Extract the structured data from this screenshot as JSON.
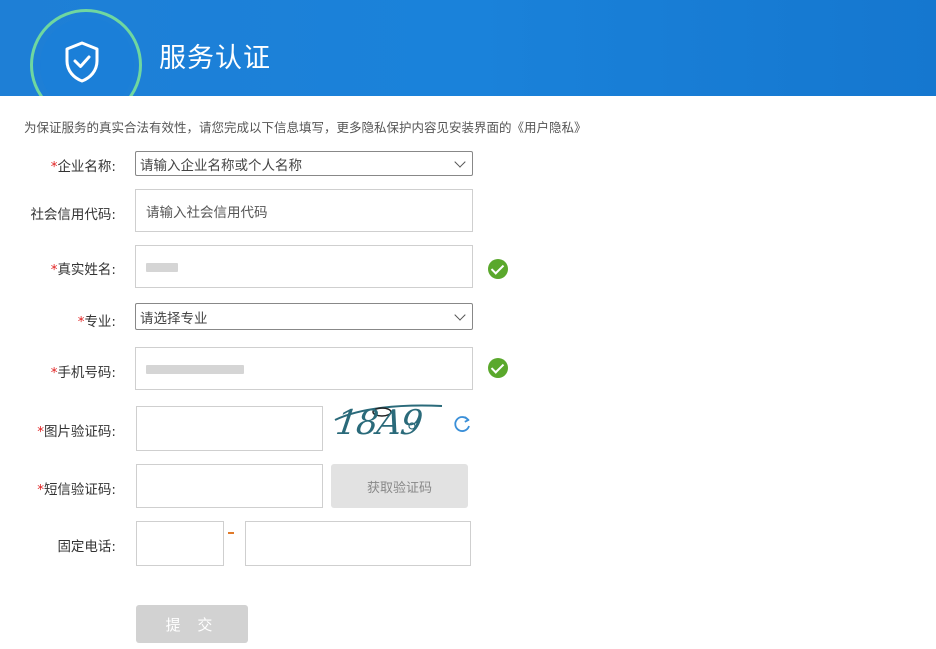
{
  "header": {
    "title": "服务认证",
    "logo_icon": "shield-check-icon"
  },
  "notice": "为保证服务的真实合法有效性，请您完成以下信息填写，更多隐私保护内容见安装界面的《用户隐私》",
  "form": {
    "company": {
      "label": "企业名称:",
      "value": "请输入企业名称或个人名称",
      "required": true
    },
    "credit_code": {
      "label": "社会信用代码:",
      "placeholder": "请输入社会信用代码",
      "required": false
    },
    "real_name": {
      "label": "真实姓名:",
      "required": true,
      "verified": true
    },
    "major": {
      "label": "专业:",
      "value": "请选择专业",
      "required": true
    },
    "phone": {
      "label": "手机号码:",
      "required": true,
      "verified": true
    },
    "image_captcha": {
      "label": "图片验证码:",
      "required": true,
      "captcha_text": "18A9"
    },
    "sms_code": {
      "label": "短信验证码:",
      "required": true,
      "button": "获取验证码"
    },
    "landline": {
      "label": "固定电话:",
      "separator": "-",
      "required": false
    },
    "submit": "提 交"
  },
  "colors": {
    "header_bg": "#1a82da",
    "required": "#e02020",
    "verified": "#5aa82c"
  }
}
